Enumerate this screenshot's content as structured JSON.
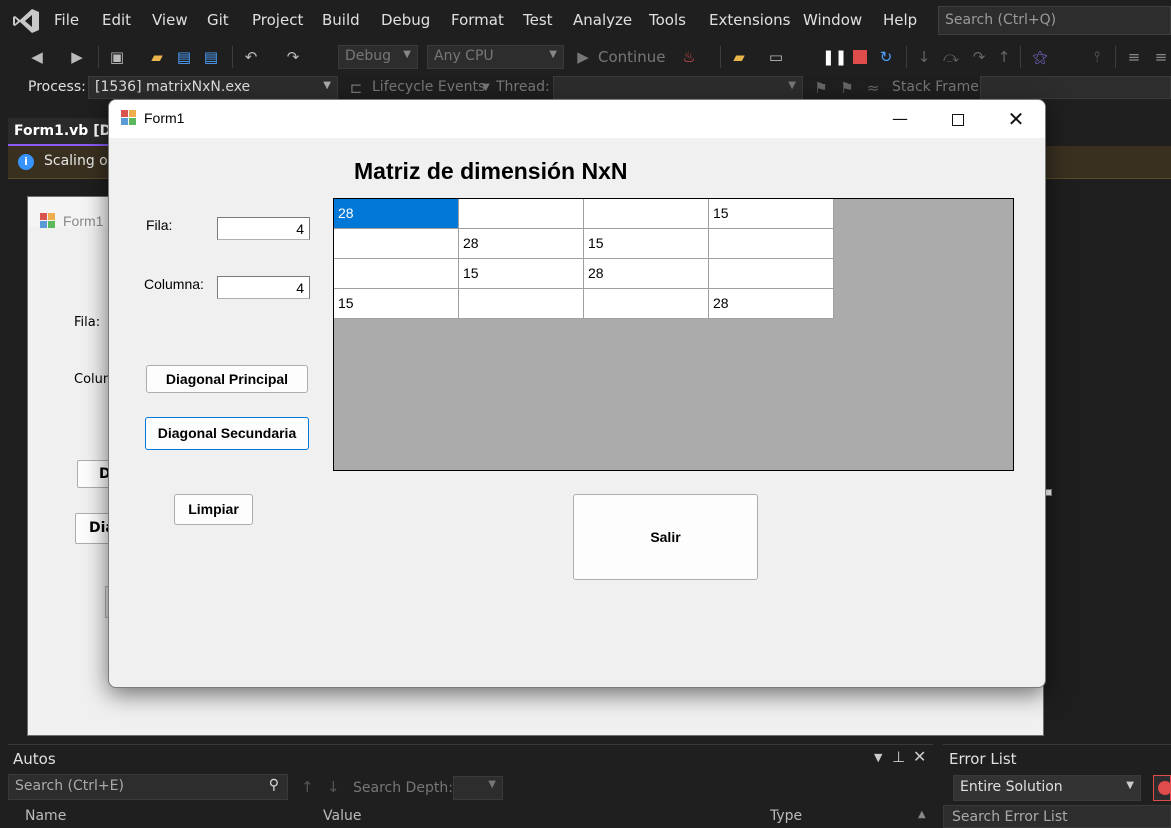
{
  "menu": {
    "items": [
      "File",
      "Edit",
      "View",
      "Git",
      "Project",
      "Build",
      "Debug",
      "Format",
      "Test",
      "Analyze",
      "Tools",
      "Extensions",
      "Window",
      "Help"
    ],
    "search_placeholder": "Search (Ctrl+Q)"
  },
  "toolbar": {
    "config": "Debug",
    "platform": "Any CPU",
    "continue_label": "Continue"
  },
  "processbar": {
    "process_label": "Process:",
    "process_value": "[1536] matrixNxN.exe",
    "lifecycle_label": "Lifecycle Events",
    "thread_label": "Thread:",
    "stackframe_label": "Stack Frame:"
  },
  "editor": {
    "tab_label": "Form1.vb [De",
    "info_text": "Scaling o"
  },
  "designer": {
    "title": "Form1",
    "fila_label": "Fila:",
    "columna_label": "Colum",
    "btn1": "D",
    "btn2": "Dia"
  },
  "form1": {
    "title": "Form1",
    "heading": "Matriz de dimensión NxN",
    "fila_label": "Fila:",
    "fila_value": "4",
    "columna_label": "Columna:",
    "columna_value": "4",
    "btn_diag_principal": "Diagonal Principal",
    "btn_diag_secundaria": "Diagonal Secundaria",
    "btn_limpiar": "Limpiar",
    "btn_salir": "Salir",
    "matrix": [
      [
        "28",
        "",
        "",
        "15"
      ],
      [
        "",
        "28",
        "15",
        ""
      ],
      [
        "",
        "15",
        "28",
        ""
      ],
      [
        "15",
        "",
        "",
        "28"
      ]
    ]
  },
  "autos": {
    "title": "Autos",
    "search_placeholder": "Search (Ctrl+E)",
    "search_depth_label": "Search Depth:",
    "col_name": "Name",
    "col_value": "Value",
    "col_type": "Type"
  },
  "errors": {
    "title": "Error List",
    "scope": "Entire Solution",
    "search_placeholder": "Search Error List"
  },
  "colors": {
    "selection": "#0078d7",
    "ide_background": "#1f1f1f",
    "form_background": "#f0f0f0",
    "grid_background": "#ababab"
  }
}
